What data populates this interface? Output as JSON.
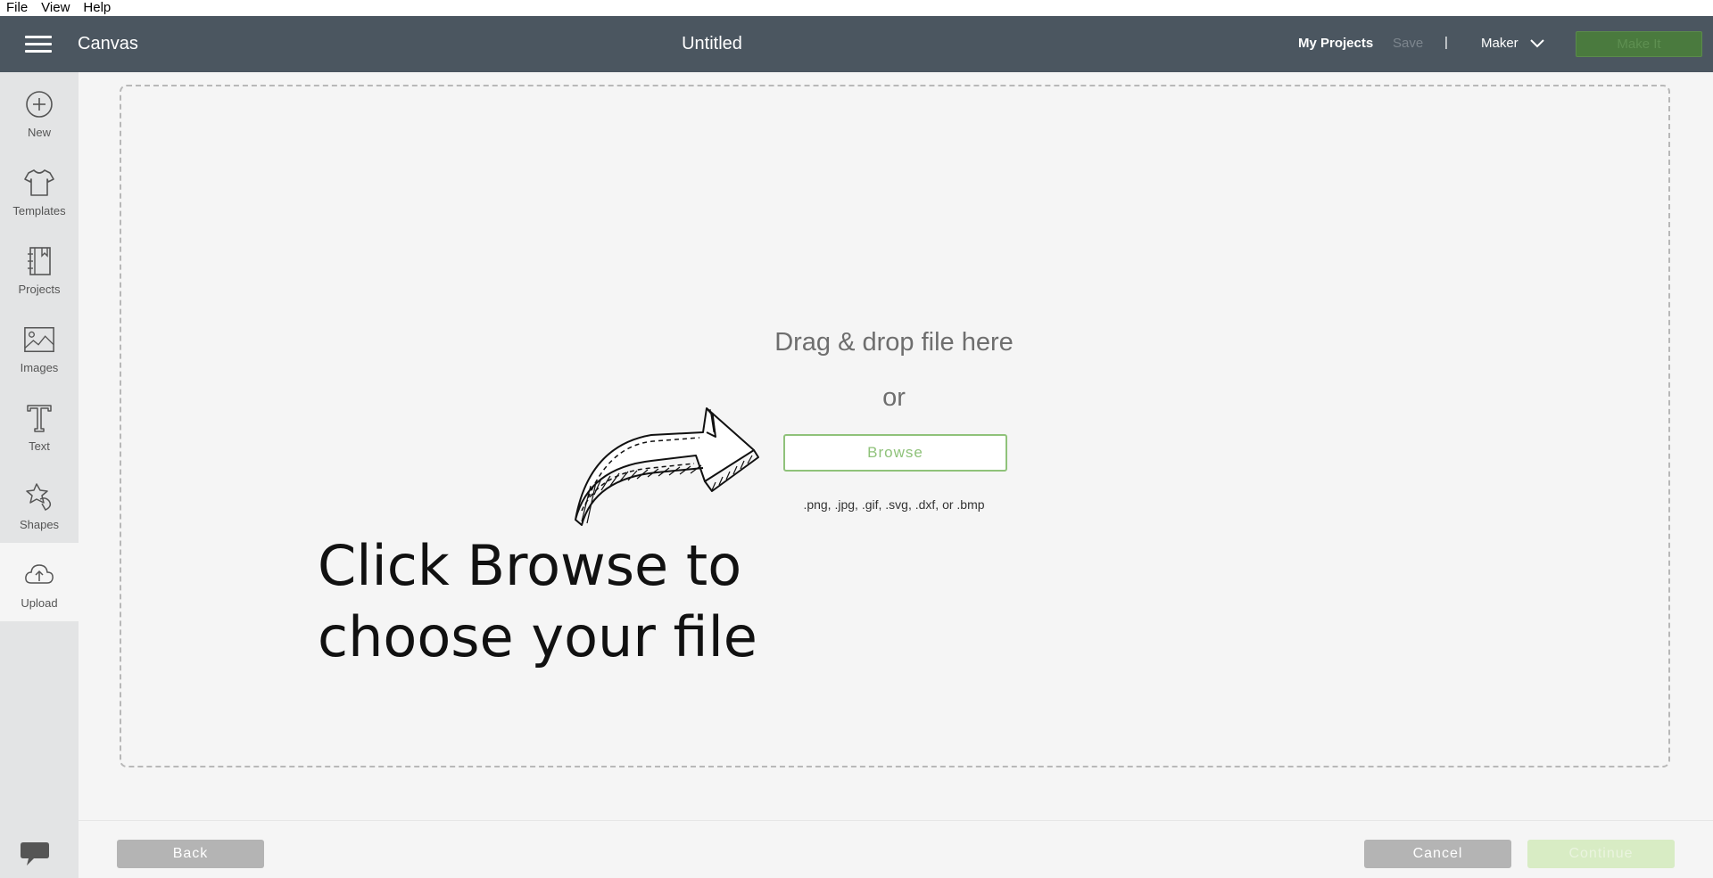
{
  "menubar": {
    "items": [
      "File",
      "View",
      "Help"
    ]
  },
  "header": {
    "app_title": "Canvas",
    "doc_title": "Untitled",
    "my_projects": "My Projects",
    "save": "Save",
    "separator": "|",
    "machine": "Maker",
    "make_it": "Make It"
  },
  "sidebar": {
    "items": [
      {
        "label": "New",
        "icon": "plus-circle-icon"
      },
      {
        "label": "Templates",
        "icon": "tshirt-icon"
      },
      {
        "label": "Projects",
        "icon": "notebook-icon"
      },
      {
        "label": "Images",
        "icon": "image-icon"
      },
      {
        "label": "Text",
        "icon": "text-t-icon"
      },
      {
        "label": "Shapes",
        "icon": "shapes-icon"
      },
      {
        "label": "Upload",
        "icon": "cloud-upload-icon"
      }
    ],
    "active": "Upload"
  },
  "upload": {
    "drop_text": "Drag & drop file here",
    "or_text": "or",
    "browse": "Browse",
    "formats": ".png, .jpg, .gif, .svg, .dxf, or .bmp"
  },
  "annotation": {
    "line1": "Click Browse to",
    "line2": "choose your file"
  },
  "footer": {
    "back": "Back",
    "cancel": "Cancel",
    "continue": "Continue"
  },
  "colors": {
    "header_bg": "#4b5660",
    "accent_green": "#8fc27a",
    "make_it_bg": "#4a7a3e",
    "sidebar_bg": "#e3e4e5"
  }
}
